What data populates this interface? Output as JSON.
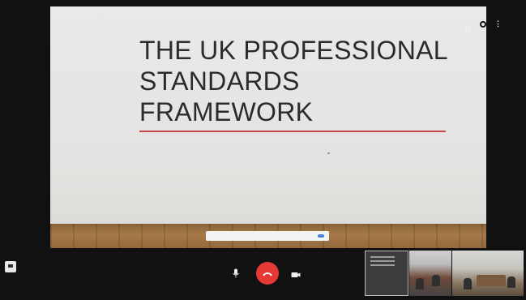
{
  "slide": {
    "title": "THE UK PROFESSIONAL\nSTANDARDS\nFRAMEWORK",
    "author": "",
    "lines": [
      "",
      "",
      ""
    ]
  },
  "share_bar": {
    "message": "",
    "stop_label": "",
    "hide_label": ""
  },
  "controls": {
    "icons": [
      "people-icon",
      "gear-icon",
      "more-icon",
      "microphone-icon",
      "end-call-icon",
      "camera-icon",
      "chat-icon"
    ]
  },
  "thumbnails": [
    {
      "label": ""
    },
    {
      "label": ""
    },
    {
      "label": ""
    }
  ],
  "colors": {
    "end_call": "#e53935",
    "slide_rule": "#c8454a",
    "background": "#111111"
  }
}
